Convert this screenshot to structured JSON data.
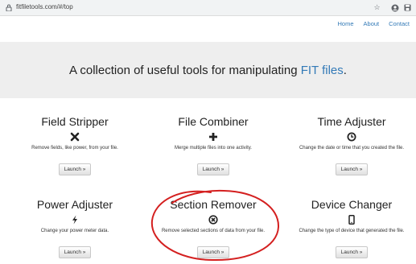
{
  "browser": {
    "url": "fitfiletools.com/#/top"
  },
  "nav": {
    "home": "Home",
    "about": "About",
    "contact": "Contact"
  },
  "hero": {
    "text_before": "A collection of useful tools for manipulating ",
    "link": "FIT files",
    "text_after": "."
  },
  "tools": [
    {
      "title": "Field Stripper",
      "icon": "x-icon",
      "description": "Remove fields, like power, from your file.",
      "button": "Launch »"
    },
    {
      "title": "File Combiner",
      "icon": "plus-icon",
      "description": "Merge multiple files into one activity.",
      "button": "Launch »"
    },
    {
      "title": "Time Adjuster",
      "icon": "clock-icon",
      "description": "Change the date or time that you created the file.",
      "button": "Launch »"
    },
    {
      "title": "Power Adjuster",
      "icon": "lightning-icon",
      "description": "Change your power meter data.",
      "button": "Launch »"
    },
    {
      "title": "Section Remover",
      "icon": "circle-x-icon",
      "description": "Remove selected sections of data from your file.",
      "button": "Launch »"
    },
    {
      "title": "Device Changer",
      "icon": "phone-icon",
      "description": "Change the type of device that generated the file.",
      "button": "Launch »"
    }
  ],
  "annotation_color": "#d42020"
}
